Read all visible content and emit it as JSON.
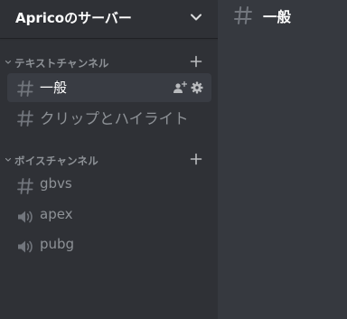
{
  "server": {
    "name": "Apricoのサーバー"
  },
  "categories": [
    {
      "label": "テキストチャンネル",
      "channels": [
        {
          "label": "一般",
          "type": "text",
          "selected": true
        },
        {
          "label": "クリップとハイライト",
          "type": "text",
          "selected": false
        }
      ]
    },
    {
      "label": "ボイスチャンネル",
      "channels": [
        {
          "label": "gbvs",
          "type": "text",
          "selected": false
        },
        {
          "label": "apex",
          "type": "voice",
          "selected": false
        },
        {
          "label": "pubg",
          "type": "voice",
          "selected": false
        }
      ]
    }
  ],
  "main": {
    "channel_title": "一般"
  },
  "colors": {
    "sidebar_bg": "#2f3136",
    "main_bg": "#36393f",
    "selected_bg": "#393c43",
    "muted_text": "#8e9297",
    "icon": "#72767d",
    "white": "#ffffff"
  }
}
